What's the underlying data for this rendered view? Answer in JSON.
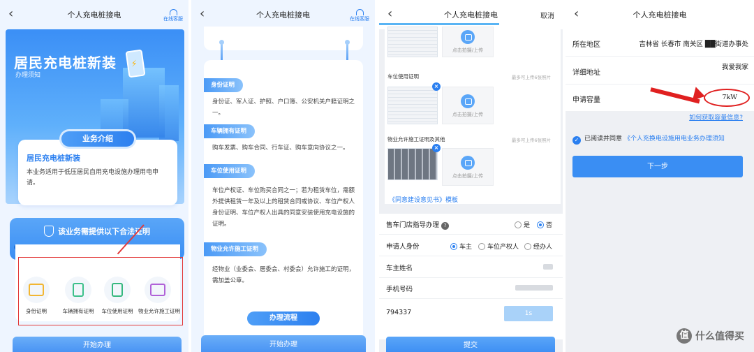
{
  "screens": {
    "s1": {
      "title": "个人充电桩接电",
      "back": "‹",
      "service": "在线客服",
      "hero_title": "居民充电桩新装",
      "hero_sub": "办理须知",
      "biz_intro_tag": "业务介绍",
      "card_title": "居民充电桩新装",
      "card_desc": "本业务适用于低压居民自用充电设施办理用电申请。",
      "cert_title": "该业务需提供以下合法证明",
      "docs": [
        "身份证明",
        "车辆拥有证明",
        "车位使用证明",
        "物业允许施工证明"
      ],
      "start": "开始办理"
    },
    "s2": {
      "title": "个人充电桩接电",
      "back": "‹",
      "service": "在线客服",
      "sections": [
        {
          "tag": "身份证明",
          "text": "身份证、军人证、护照、户口簿、公安机关户籍证明之一。"
        },
        {
          "tag": "车辆拥有证明",
          "text": "购车发票、购车合同、行车证、购车意向协议之一。"
        },
        {
          "tag": "车位使用证明",
          "text": "车位产权证、车位购买合同之一；若为租赁车位，需额外提供租赁一年及以上的租赁合同或协议、车位产权人身份证明、车位产权人出具的同意安装使用充电设施的证明。"
        },
        {
          "tag": "物业允许施工证明",
          "text": "经物业（业委会、居委会、村委会）允许施工的证明，需加盖公章。"
        }
      ],
      "flow_tag": "办理流程",
      "start": "开始办理"
    },
    "s3": {
      "title": "个人充电桩接电",
      "back": "‹",
      "cancel": "取消",
      "upload_label": "点击拍摄/上传",
      "parking_label": "车位使用证明",
      "parking_hint": "最多可上传6张照片",
      "property_label": "物业允许施工证明及其他",
      "property_hint": "最多可上传6张照片",
      "template_link": "《同意建设意见书》模板",
      "dealer_label": "售车门店指导办理",
      "yes": "是",
      "no": "否",
      "applicant_label": "申请人身份",
      "applicant_options": [
        "车主",
        "车位产权人",
        "经办人"
      ],
      "owner_name_label": "车主姓名",
      "phone_label": "手机号码",
      "code_value": "794337",
      "sms_countdown": "1s",
      "submit": "提交"
    },
    "s4": {
      "title": "个人充电桩接电",
      "back": "‹",
      "region_label": "所在地区",
      "region_value": "吉林省 长春市 南关区 ██街道办事处",
      "address_label": "详细地址",
      "address_value": "我爱我家",
      "capacity_label": "申请容量",
      "capacity_value": "7kW",
      "how_link": "如何获取容量信息?",
      "agree_prefix": "已阅读并同意",
      "agree_link": "《个人充换电设施用电业务办理须知",
      "next": "下一步"
    }
  },
  "watermark": "什么值得买",
  "watermark_logo": "值",
  "colors": {
    "accent": "#2a7ff0",
    "annotation": "#e02020"
  }
}
